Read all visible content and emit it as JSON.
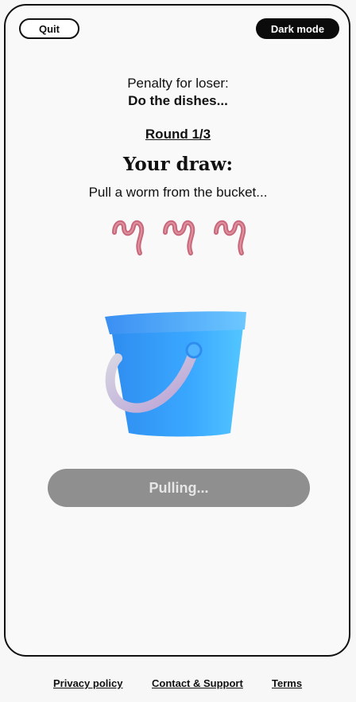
{
  "header": {
    "quit_label": "Quit",
    "dark_mode_label": "Dark mode"
  },
  "penalty": {
    "label": "Penalty for loser:",
    "value": "Do the dishes..."
  },
  "round": {
    "label": "Round 1/3"
  },
  "draw": {
    "heading": "Your draw:",
    "instruction": "Pull a worm from the bucket..."
  },
  "icons": {
    "worm": "worm-icon",
    "bucket": "bucket-icon"
  },
  "action": {
    "pull_label": "Pulling..."
  },
  "footer": {
    "privacy_label": "Privacy policy",
    "contact_label": "Contact & Support",
    "terms_label": "Terms"
  },
  "colors": {
    "background": "#f7f7f7",
    "dark_button": "#0b0b0b",
    "disabled_button": "#8f8f8f",
    "bucket_blue": "#3aa8ff",
    "worm_pink": "#c9687b"
  }
}
